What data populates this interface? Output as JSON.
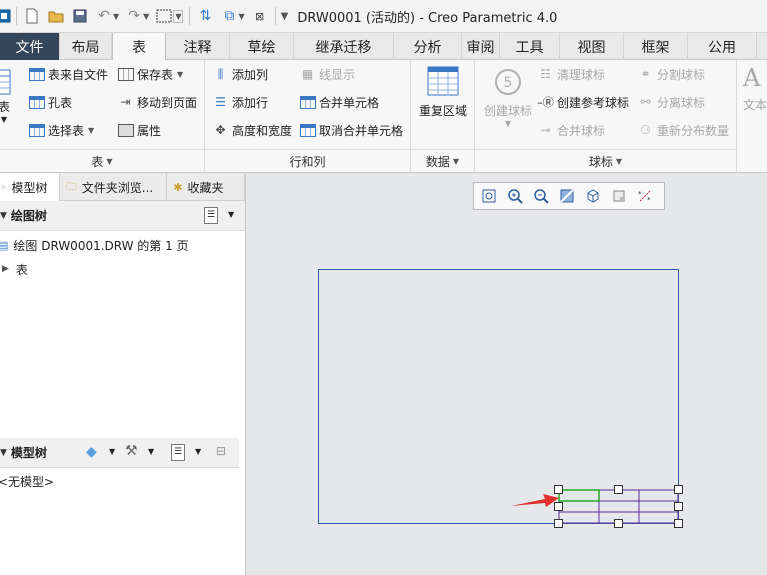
{
  "window": {
    "title": "DRW0001 (活动的) - Creo Parametric 4.0"
  },
  "quick_access": {
    "icons": [
      "app-icon",
      "new-icon",
      "open-icon",
      "save-icon",
      "undo-icon",
      "redo-icon",
      "select-box-icon",
      "regenerate-icon",
      "switch-window-icon",
      "close-window-icon",
      "customize-icon"
    ]
  },
  "tabs": [
    "文件",
    "布局",
    "表",
    "注释",
    "草绘",
    "继承迁移",
    "分析",
    "审阅",
    "工具",
    "视图",
    "框架",
    "公用"
  ],
  "ribbon": {
    "table_group": {
      "title": "表",
      "partial_big": "表",
      "table_from_file": "表来自文件",
      "save_table": "保存表",
      "hole_table": "孔表",
      "move_to_page": "移动到页面",
      "select_table": "选择表",
      "properties": "属性"
    },
    "rows_cols_group": {
      "title": "行和列",
      "add_column": "添加列",
      "line_display": "线显示",
      "add_row": "添加行",
      "merge_cells": "合并单元格",
      "height_width": "高度和宽度",
      "unmerge_cells": "取消合并单元格"
    },
    "data_group": {
      "title": "数据",
      "repeat_region": "重复区域"
    },
    "balloon_group": {
      "title": "球标",
      "create_balloon": "创建球标",
      "clean_balloons": "清理球标",
      "split_balloon": "分割球标",
      "create_ref_balloon": "创建参考球标",
      "detach_balloon": "分离球标",
      "merge_balloons": "合并球标",
      "redistribute_qty": "重新分布数量"
    },
    "text_group": {
      "partial_label": "文本"
    }
  },
  "left_panel": {
    "tabs": [
      "模型树",
      "文件夹浏览...",
      "收藏夹"
    ],
    "drawing_tree": {
      "title": "绘图树",
      "items": [
        "绘图 DRW0001.DRW 的第 1 页",
        "表"
      ]
    },
    "model_tree": {
      "title": "模型树",
      "empty_text": "<无模型>"
    }
  },
  "view_toolbar": {
    "icons": [
      "refit-icon",
      "zoom-in-icon",
      "zoom-out-icon",
      "repaint-icon",
      "display-style-icon",
      "annotation-display-icon",
      "datum-display-icon"
    ]
  },
  "colors": {
    "file_tab": "#34465a",
    "sheet_border": "#2f5aa8",
    "selection_green": "#22aa22",
    "table_purple": "#5a2d9a",
    "arrow_red": "#e03030"
  }
}
